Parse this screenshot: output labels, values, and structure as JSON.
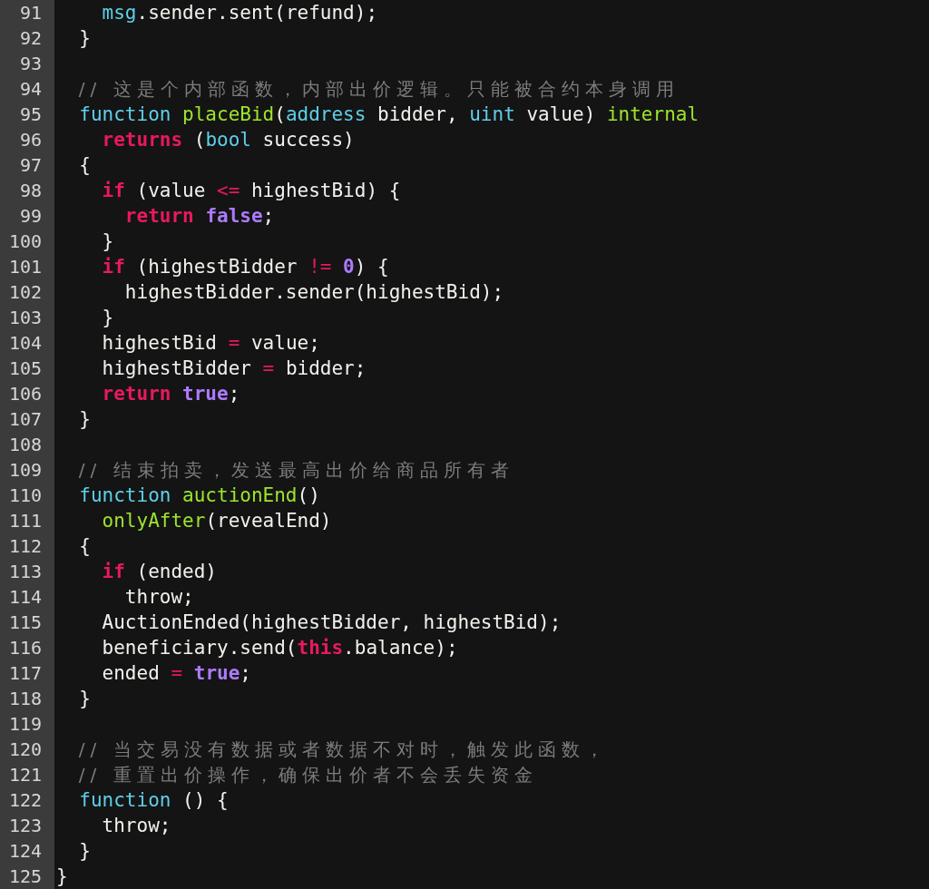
{
  "editor": {
    "lines": [
      {
        "number": "91",
        "tokens": [
          {
            "text": "    msg",
            "kind": "type"
          },
          {
            "text": ".sender.sent(refund);",
            "kind": "plain"
          }
        ]
      },
      {
        "number": "92",
        "tokens": [
          {
            "text": "  }",
            "kind": "plain"
          }
        ]
      },
      {
        "number": "93"
      },
      {
        "number": "94",
        "tokens": [
          {
            "text": "  // 这是个内部函数，内部出价逻辑。只能被合约本身调用",
            "kind": "comment"
          }
        ]
      },
      {
        "number": "95",
        "tokens": [
          {
            "text": "  function ",
            "kind": "type"
          },
          {
            "text": "placeBid",
            "kind": "func"
          },
          {
            "text": "(",
            "kind": "plain"
          },
          {
            "text": "address",
            "kind": "type"
          },
          {
            "text": " bidder, ",
            "kind": "plain"
          },
          {
            "text": "uint",
            "kind": "type"
          },
          {
            "text": " value) ",
            "kind": "plain"
          },
          {
            "text": "internal",
            "kind": "func"
          }
        ]
      },
      {
        "number": "96",
        "tokens": [
          {
            "text": "    returns",
            "kind": "keyword"
          },
          {
            "text": " (",
            "kind": "plain"
          },
          {
            "text": "bool",
            "kind": "type"
          },
          {
            "text": " success)",
            "kind": "plain"
          }
        ]
      },
      {
        "number": "97",
        "tokens": [
          {
            "text": "  {",
            "kind": "plain"
          }
        ]
      },
      {
        "number": "98",
        "tokens": [
          {
            "text": "    if",
            "kind": "keyword"
          },
          {
            "text": " (value ",
            "kind": "plain"
          },
          {
            "text": "<=",
            "kind": "operator"
          },
          {
            "text": " highestBid) {",
            "kind": "plain"
          }
        ]
      },
      {
        "number": "99",
        "tokens": [
          {
            "text": "      return ",
            "kind": "keyword"
          },
          {
            "text": "false",
            "kind": "constant"
          },
          {
            "text": ";",
            "kind": "plain"
          }
        ]
      },
      {
        "number": "100",
        "tokens": [
          {
            "text": "    }",
            "kind": "plain"
          }
        ]
      },
      {
        "number": "101",
        "tokens": [
          {
            "text": "    if",
            "kind": "keyword"
          },
          {
            "text": " (highestBidder ",
            "kind": "plain"
          },
          {
            "text": "!= ",
            "kind": "operator"
          },
          {
            "text": "0",
            "kind": "constant"
          },
          {
            "text": ") {",
            "kind": "plain"
          }
        ]
      },
      {
        "number": "102",
        "tokens": [
          {
            "text": "      highestBidder.sender(highestBid);",
            "kind": "plain"
          }
        ]
      },
      {
        "number": "103",
        "tokens": [
          {
            "text": "    }",
            "kind": "plain"
          }
        ]
      },
      {
        "number": "104",
        "tokens": [
          {
            "text": "    highestBid ",
            "kind": "plain"
          },
          {
            "text": "=",
            "kind": "operator"
          },
          {
            "text": " value;",
            "kind": "plain"
          }
        ]
      },
      {
        "number": "105",
        "tokens": [
          {
            "text": "    highestBidder ",
            "kind": "plain"
          },
          {
            "text": "=",
            "kind": "operator"
          },
          {
            "text": " bidder;",
            "kind": "plain"
          }
        ]
      },
      {
        "number": "106",
        "tokens": [
          {
            "text": "    return ",
            "kind": "keyword"
          },
          {
            "text": "true",
            "kind": "constant"
          },
          {
            "text": ";",
            "kind": "plain"
          }
        ]
      },
      {
        "number": "107",
        "tokens": [
          {
            "text": "  }",
            "kind": "plain"
          }
        ]
      },
      {
        "number": "108"
      },
      {
        "number": "109",
        "tokens": [
          {
            "text": "  // 结束拍卖，发送最高出价给商品所有者",
            "kind": "comment"
          }
        ]
      },
      {
        "number": "110",
        "tokens": [
          {
            "text": "  function ",
            "kind": "type"
          },
          {
            "text": "auctionEnd",
            "kind": "func"
          },
          {
            "text": "()",
            "kind": "plain"
          }
        ]
      },
      {
        "number": "111",
        "tokens": [
          {
            "text": "    onlyAfter",
            "kind": "func"
          },
          {
            "text": "(revealEnd)",
            "kind": "plain"
          }
        ]
      },
      {
        "number": "112",
        "tokens": [
          {
            "text": "  {",
            "kind": "plain"
          }
        ]
      },
      {
        "number": "113",
        "tokens": [
          {
            "text": "    if",
            "kind": "keyword"
          },
          {
            "text": " (ended)",
            "kind": "plain"
          }
        ]
      },
      {
        "number": "114",
        "tokens": [
          {
            "text": "      throw;",
            "kind": "plain"
          }
        ]
      },
      {
        "number": "115",
        "tokens": [
          {
            "text": "    AuctionEnded(highestBidder, highestBid);",
            "kind": "plain"
          }
        ]
      },
      {
        "number": "116",
        "tokens": [
          {
            "text": "    beneficiary.send(",
            "kind": "plain"
          },
          {
            "text": "this",
            "kind": "keyword"
          },
          {
            "text": ".balance);",
            "kind": "plain"
          }
        ]
      },
      {
        "number": "117",
        "tokens": [
          {
            "text": "    ended ",
            "kind": "plain"
          },
          {
            "text": "= ",
            "kind": "operator"
          },
          {
            "text": "true",
            "kind": "constant"
          },
          {
            "text": ";",
            "kind": "plain"
          }
        ]
      },
      {
        "number": "118",
        "tokens": [
          {
            "text": "  }",
            "kind": "plain"
          }
        ]
      },
      {
        "number": "119"
      },
      {
        "number": "120",
        "tokens": [
          {
            "text": "  // 当交易没有数据或者数据不对时，触发此函数，",
            "kind": "comment"
          }
        ]
      },
      {
        "number": "121",
        "tokens": [
          {
            "text": "  // 重置出价操作，确保出价者不会丢失资金",
            "kind": "comment"
          }
        ]
      },
      {
        "number": "122",
        "tokens": [
          {
            "text": "  function",
            "kind": "type"
          },
          {
            "text": " () {",
            "kind": "plain"
          }
        ]
      },
      {
        "number": "123",
        "tokens": [
          {
            "text": "    throw;",
            "kind": "plain"
          }
        ]
      },
      {
        "number": "124",
        "tokens": [
          {
            "text": "  }",
            "kind": "plain"
          }
        ]
      },
      {
        "number": "125",
        "tokens": [
          {
            "text": "}",
            "kind": "plain"
          }
        ]
      }
    ]
  }
}
